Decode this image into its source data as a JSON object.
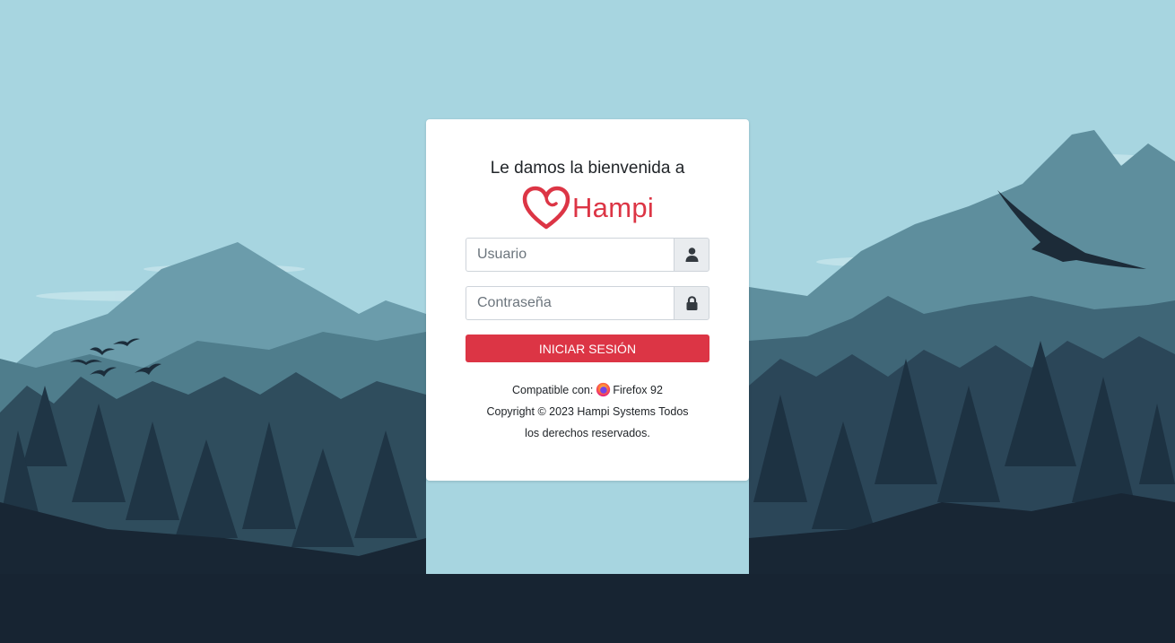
{
  "login": {
    "welcome": "Le damos la bienvenida a",
    "brand": "Hampi",
    "username_placeholder": "Usuario",
    "password_placeholder": "Contraseña",
    "submit_label": "INICIAR SESIÓN",
    "compat_label": "Compatible con:",
    "browser": "Firefox 92",
    "copyright": "Copyright © 2023 Hampi Systems Todos los derechos reservados."
  },
  "icons": {
    "user": "user-icon",
    "lock": "lock-icon",
    "brand": "heart-logo-icon",
    "browser": "firefox-icon"
  },
  "colors": {
    "accent": "#dc3545",
    "sky": "#a7d5e0",
    "foreground": "#1a2633"
  }
}
